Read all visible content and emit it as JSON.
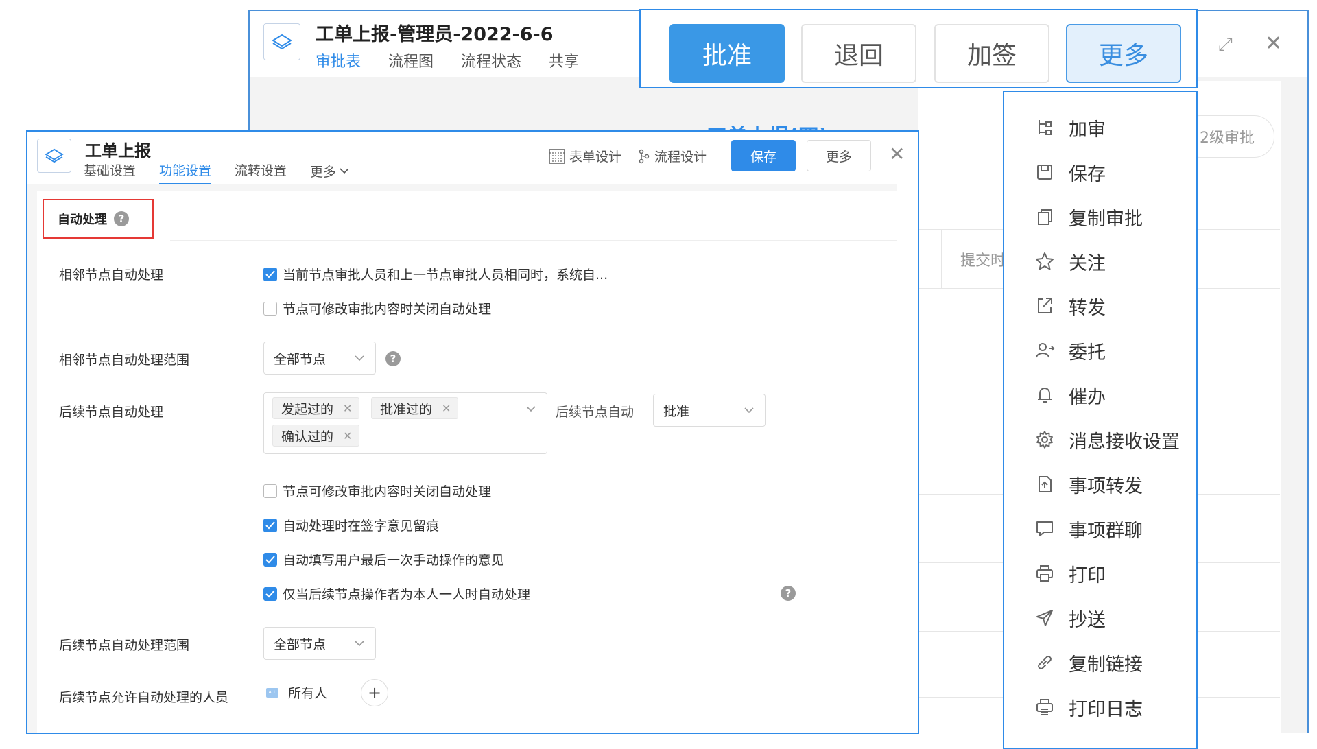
{
  "back_window": {
    "title": "工单上报-管理员-2022-6-6",
    "tabs": [
      {
        "label": "审批表",
        "active": true
      },
      {
        "label": "流程图",
        "active": false
      },
      {
        "label": "流程状态",
        "active": false
      },
      {
        "label": "共享",
        "active": false
      }
    ],
    "doc_title": "工单上报(四)",
    "level_chip": "2级审批",
    "submit_label": "提交时"
  },
  "action_bar": {
    "approve": "批准",
    "return": "退回",
    "countersign": "加签",
    "more": "更多"
  },
  "more_menu": {
    "items": [
      {
        "label": "加审",
        "icon": "add-reviewer-icon"
      },
      {
        "label": "保存",
        "icon": "save-icon"
      },
      {
        "label": "复制审批",
        "icon": "copy-icon"
      },
      {
        "label": "关注",
        "icon": "star-icon"
      },
      {
        "label": "转发",
        "icon": "forward-icon"
      },
      {
        "label": "委托",
        "icon": "delegate-icon"
      },
      {
        "label": "催办",
        "icon": "bell-icon"
      },
      {
        "label": "消息接收设置",
        "icon": "gear-icon"
      },
      {
        "label": "事项转发",
        "icon": "file-upload-icon"
      },
      {
        "label": "事项群聊",
        "icon": "chat-icon"
      },
      {
        "label": "打印",
        "icon": "printer-icon"
      },
      {
        "label": "抄送",
        "icon": "send-icon"
      },
      {
        "label": "复制链接",
        "icon": "link-icon"
      },
      {
        "label": "打印日志",
        "icon": "print-log-icon"
      }
    ]
  },
  "front_window": {
    "title": "工单上报",
    "tabs": [
      {
        "label": "基础设置",
        "active": false
      },
      {
        "label": "功能设置",
        "active": true
      },
      {
        "label": "流转设置",
        "active": false
      },
      {
        "label": "更多",
        "active": false
      }
    ],
    "form_design": "表单设计",
    "flow_design": "流程设计",
    "save": "保存",
    "more": "更多"
  },
  "settings": {
    "section_title": "自动处理",
    "adjacent_label": "相邻节点自动处理",
    "adjacent_opt1": "当前节点审批人员和上一节点审批人员相同时，系统自...",
    "adjacent_opt2": "节点可修改审批内容时关闭自动处理",
    "adjacent_range_label": "相邻节点自动处理范围",
    "adjacent_range_value": "全部节点",
    "subsequent_label": "后续节点自动处理",
    "tags": [
      "发起过的",
      "批准过的",
      "确认过的"
    ],
    "subsequent_auto_label": "后续节点自动",
    "subsequent_auto_value": "批准",
    "sub_opt1": "节点可修改审批内容时关闭自动处理",
    "sub_opt2": "自动处理时在签字意见留痕",
    "sub_opt3": "自动填写用户最后一次手动操作的意见",
    "sub_opt4": "仅当后续节点操作者为本人一人时自动处理",
    "subsequent_range_label": "后续节点自动处理范围",
    "subsequent_range_value": "全部节点",
    "allowed_people_label": "后续节点允许自动处理的人员",
    "allowed_people_value": "所有人",
    "all_badge": "ALL",
    "checked": {
      "adjacent_opt1": true,
      "adjacent_opt2": false,
      "sub_opt1": false,
      "sub_opt2": true,
      "sub_opt3": true,
      "sub_opt4": true
    }
  },
  "colors": {
    "accent": "#2f8be8",
    "highlight_border": "#e53935"
  }
}
